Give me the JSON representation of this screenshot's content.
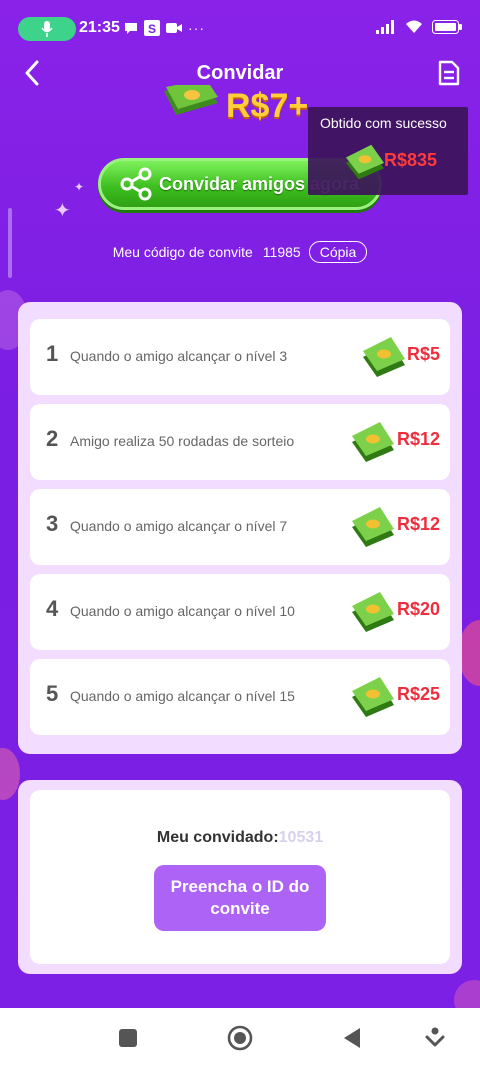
{
  "status_bar": {
    "time": "21:35",
    "icons": [
      "mic-icon",
      "chat-icon",
      "s-app-icon",
      "video-icon",
      "more-icon",
      "signal-icon",
      "wifi-icon",
      "battery-icon"
    ]
  },
  "header": {
    "title": "Convidar",
    "back_icon": "chevron-left-icon",
    "doc_icon": "document-icon"
  },
  "top_banner": {
    "amount_partial": "R$7+"
  },
  "toast": {
    "title": "Obtido com sucesso",
    "amount": "R$835"
  },
  "invite_button": {
    "label": "Convidar amigos agora"
  },
  "invite_code": {
    "label": "Meu código de convite",
    "code": "11985",
    "copy_label": "Cópia"
  },
  "rewards": [
    {
      "num": "1",
      "text": "Quando o amigo alcançar o nível 3",
      "amount": "R$5"
    },
    {
      "num": "2",
      "text": "Amigo realiza 50 rodadas de sorteio",
      "amount": "R$12"
    },
    {
      "num": "3",
      "text": "Quando o amigo alcançar o nível 7",
      "amount": "R$12"
    },
    {
      "num": "4",
      "text": "Quando o amigo alcançar o nível 10",
      "amount": "R$20"
    },
    {
      "num": "5",
      "text": "Quando o amigo alcançar o nível 15",
      "amount": "R$25"
    }
  ],
  "invited": {
    "label": "Meu convidado:",
    "value": "10531",
    "button": "Preencha o ID do convite"
  },
  "colors": {
    "background": "#7d20e6",
    "accent_green": "#3fbf22",
    "reward_red": "#ee2e3e",
    "button_purple": "#ad63f5"
  }
}
